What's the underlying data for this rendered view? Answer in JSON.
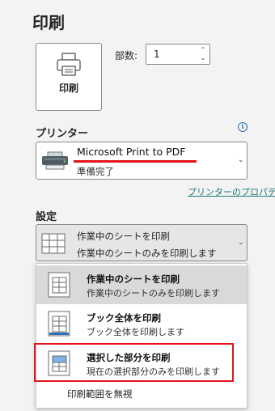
{
  "page": {
    "title": "印刷"
  },
  "print_button": {
    "label": "印刷"
  },
  "copies": {
    "label": "部数:",
    "value": "1"
  },
  "printer_section": {
    "title": "プリンター",
    "printer_name": "Microsoft Print to PDF",
    "status": "準備完了",
    "properties_link": "プリンターのプロパティ"
  },
  "settings_section": {
    "title": "設定",
    "current_title": "作業中のシートを印刷",
    "current_desc": "作業中のシートのみを印刷します"
  },
  "menu": {
    "items": [
      {
        "title": "作業中のシートを印刷",
        "desc": "作業中のシートのみを印刷します"
      },
      {
        "title": "ブック全体を印刷",
        "desc": "ブック全体を印刷します"
      },
      {
        "title": "選択した部分を印刷",
        "desc": "現在の選択部分のみを印刷します"
      }
    ],
    "ignore_print_area": "印刷範囲を無視"
  },
  "colors": {
    "highlight": "#e3141a",
    "link": "#1e7a78",
    "info": "#2b6fb6"
  }
}
